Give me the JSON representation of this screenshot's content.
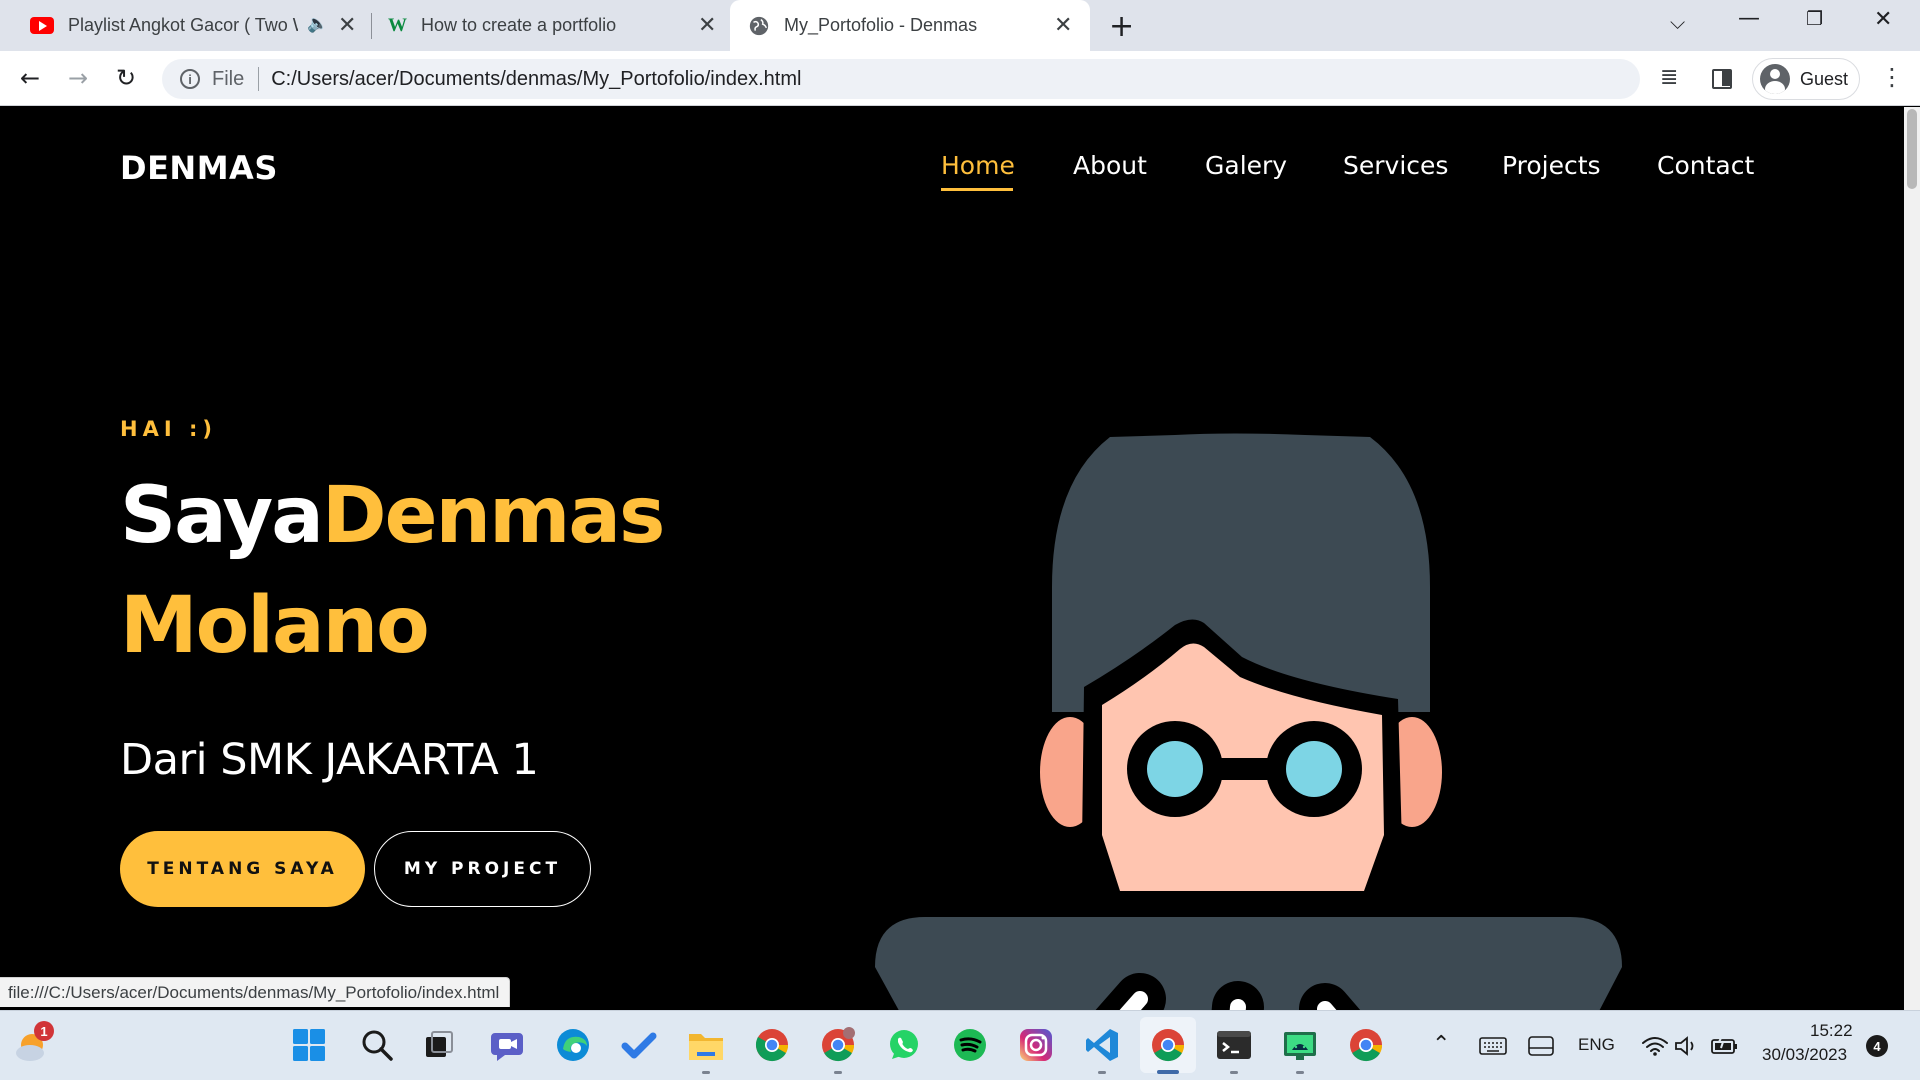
{
  "browser": {
    "tabs": [
      {
        "title": "Playlist Angkot Gacor ( Two W",
        "favicon": "youtube-icon"
      },
      {
        "title": "How to create a portfolio",
        "favicon": "w-icon"
      },
      {
        "title": "My_Portofolio - Denmas",
        "favicon": "globe-icon"
      }
    ],
    "new_tab_label": "+",
    "address": {
      "scheme_label": "File",
      "url": "C:/Users/acer/Documents/denmas/My_Portofolio/index.html"
    },
    "profile_label": "Guest",
    "status_url": "file:///C:/Users/acer/Documents/denmas/My_Portofolio/index.html"
  },
  "site": {
    "logo": "DENMAS",
    "nav": [
      "Home",
      "About",
      "Galery",
      "Services",
      "Projects",
      "Contact"
    ],
    "active_nav": "Home",
    "hero": {
      "greeting": "HAI :)",
      "name_prefix": "Saya",
      "first_name": "Denmas",
      "last_name": "Molano",
      "subtitle": "Dari SMK JAKARTA 1",
      "primary_button": "TENTANG SAYA",
      "secondary_button": "MY PROJECT"
    },
    "colors": {
      "accent": "#ffbf3c",
      "background": "#000000",
      "text": "#ffffff"
    }
  },
  "taskbar": {
    "weather_badge": "1",
    "apps": [
      "windows-start-icon",
      "search-icon",
      "task-view-icon",
      "teams-chat-icon",
      "edge-icon",
      "todo-icon",
      "file-explorer-icon",
      "chrome-icon",
      "chrome-profile-icon",
      "whatsapp-icon",
      "spotify-icon",
      "instagram-icon",
      "vscode-icon",
      "chrome-icon",
      "terminal-icon",
      "android-studio-icon",
      "chrome-icon"
    ],
    "tray": {
      "language": "ENG",
      "time": "15:22",
      "date": "30/03/2023",
      "notifications": "4"
    }
  }
}
